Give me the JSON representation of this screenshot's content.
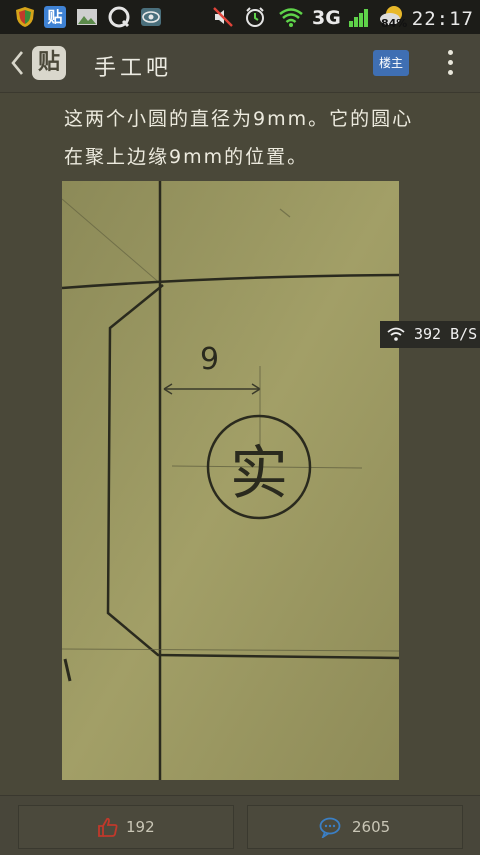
{
  "status_bar": {
    "network": "3G",
    "battery": "84%",
    "time": "22:17",
    "tieba_icon_glyph": "贴"
  },
  "header": {
    "logo_glyph": "贴",
    "forum_name": "手工吧",
    "owner_button": "楼主"
  },
  "post": {
    "line1": "这两个小圆的直径为9mm。它的圆心",
    "line2": "在聚上边缘9mm的位置。"
  },
  "photo": {
    "dimension_label": "9",
    "circle_char": "实"
  },
  "net_speed": "392 B/S",
  "bottom_bar": {
    "like_count": "192",
    "comment_count": "2605"
  },
  "colors": {
    "background": "#4a4839",
    "status_bar": "#1c1c18",
    "owner_button": "#3f6fb3",
    "like_icon": "#c0392b",
    "comment_icon": "#3b7fc4"
  }
}
